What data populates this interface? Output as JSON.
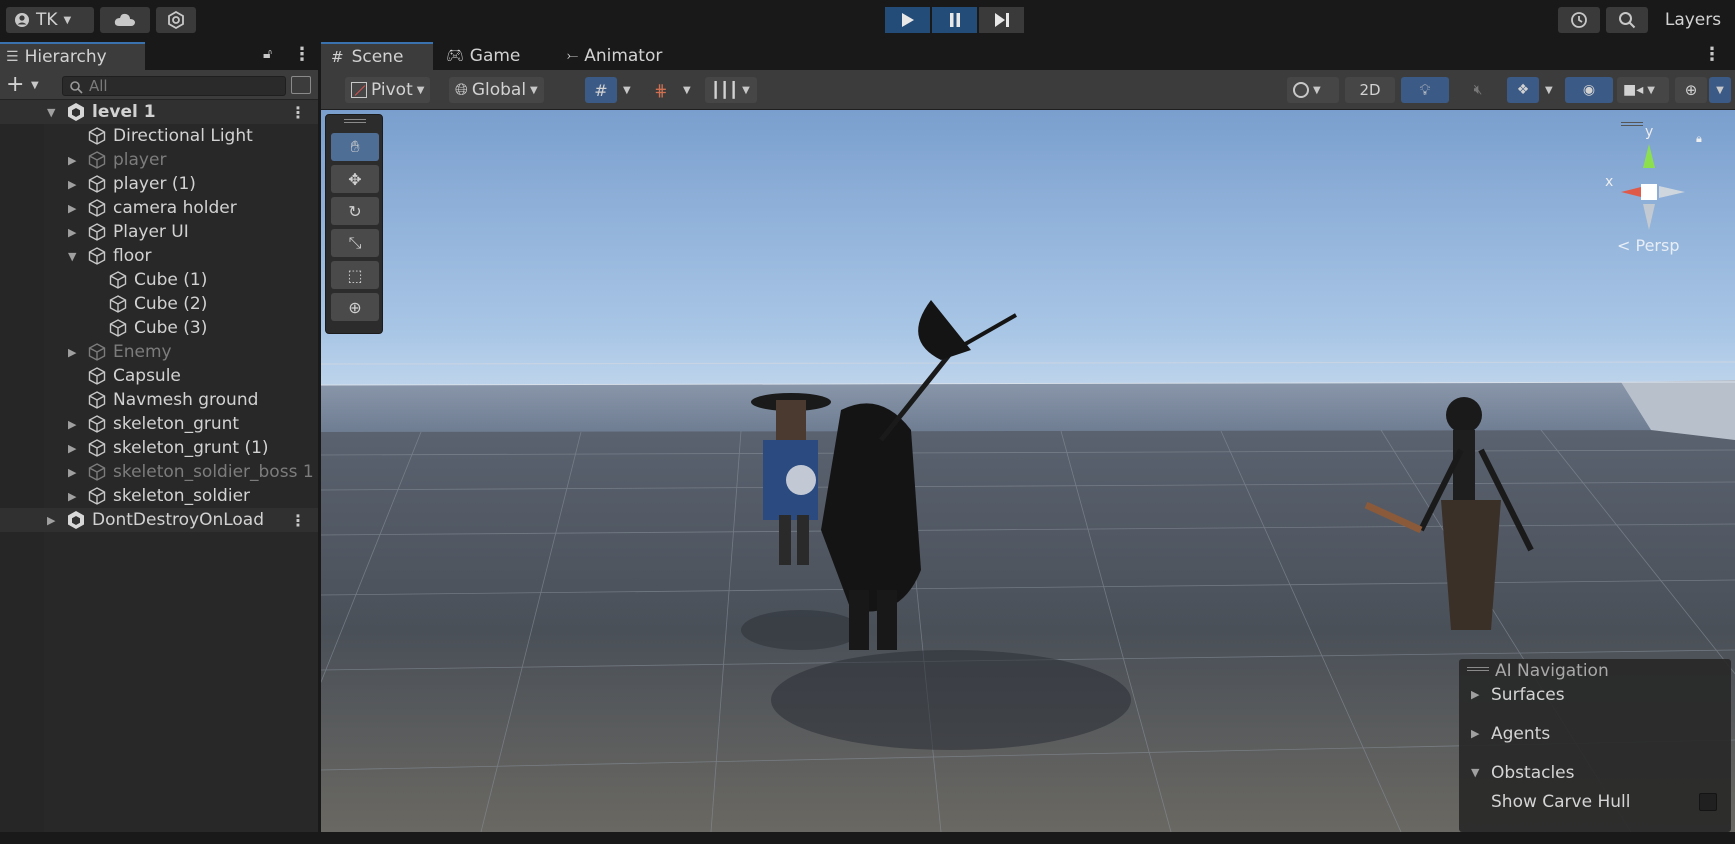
{
  "topbar": {
    "account_label": "TK",
    "layers_label": "Layers"
  },
  "hierarchy": {
    "tab_title": "Hierarchy",
    "search_placeholder": "All",
    "rows": [
      {
        "label": "level 1"
      },
      {
        "label": "Directional Light"
      },
      {
        "label": "player"
      },
      {
        "label": "player (1)"
      },
      {
        "label": "camera holder"
      },
      {
        "label": "Player UI"
      },
      {
        "label": "floor"
      },
      {
        "label": "Cube (1)"
      },
      {
        "label": "Cube (2)"
      },
      {
        "label": "Cube (3)"
      },
      {
        "label": "Enemy"
      },
      {
        "label": "Capsule"
      },
      {
        "label": "Navmesh ground"
      },
      {
        "label": "skeleton_grunt"
      },
      {
        "label": "skeleton_grunt (1)"
      },
      {
        "label": "skeleton_soldier_boss 1"
      },
      {
        "label": "skeleton_soldier"
      },
      {
        "label": "DontDestroyOnLoad"
      }
    ]
  },
  "scene": {
    "tabs": [
      "Scene",
      "Game",
      "Animator"
    ],
    "toolbar": {
      "pivot": "Pivot",
      "global": "Global",
      "mode_2d": "2D"
    },
    "gizmo": {
      "y_label": "y",
      "x_label": "x",
      "persp_label": "Persp"
    },
    "ai_navigation": {
      "title": "AI Navigation",
      "surfaces": "Surfaces",
      "agents": "Agents",
      "obstacles": "Obstacles",
      "show_carve_hull": "Show Carve Hull"
    }
  },
  "colors": {
    "accent": "#3a72b0",
    "play_blue": "#244c79",
    "panel": "#282828",
    "toolbar": "#3c3c3c"
  }
}
